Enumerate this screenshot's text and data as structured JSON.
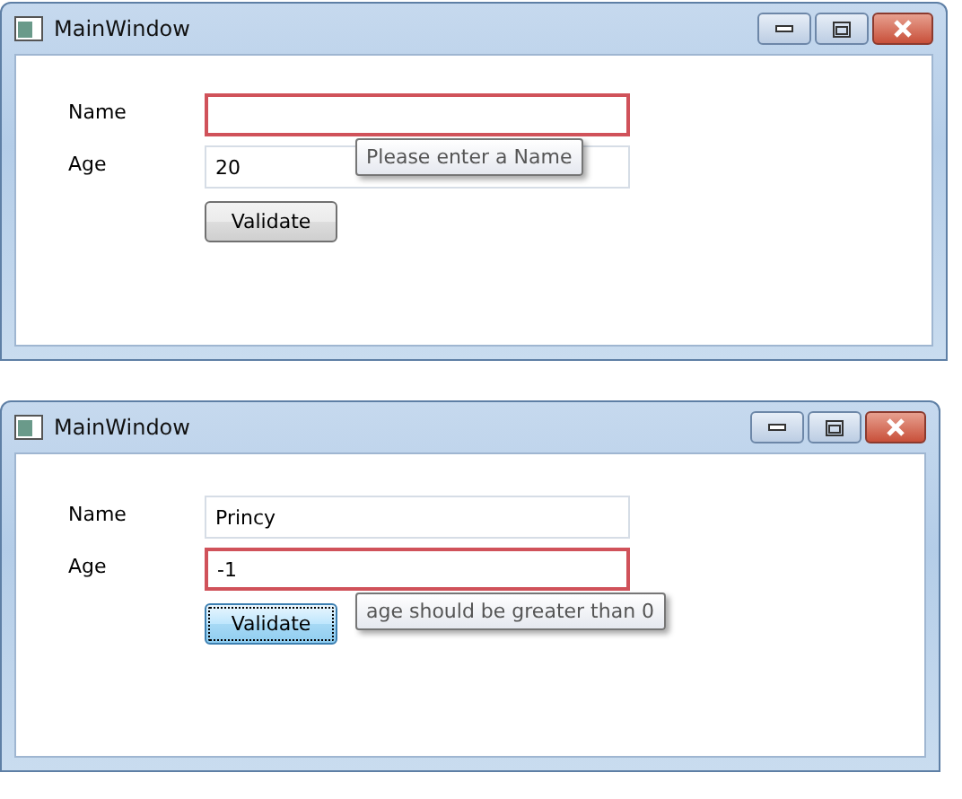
{
  "windows": [
    {
      "title": "MainWindow",
      "fields": [
        {
          "label": "Name",
          "invalid": true
        },
        {
          "label": "Age",
          "value": "20",
          "invalid": false
        }
      ],
      "error_tooltip": "Please enter a Name",
      "button": {
        "label": "Validate",
        "focused": false
      }
    },
    {
      "title": "MainWindow",
      "fields": [
        {
          "label": "Name",
          "value": "Princy",
          "invalid": false
        },
        {
          "label": "Age",
          "value": "-1",
          "invalid": true
        }
      ],
      "error_tooltip": "age should be greater than 0",
      "button": {
        "label": "Validate",
        "focused": true
      }
    }
  ]
}
